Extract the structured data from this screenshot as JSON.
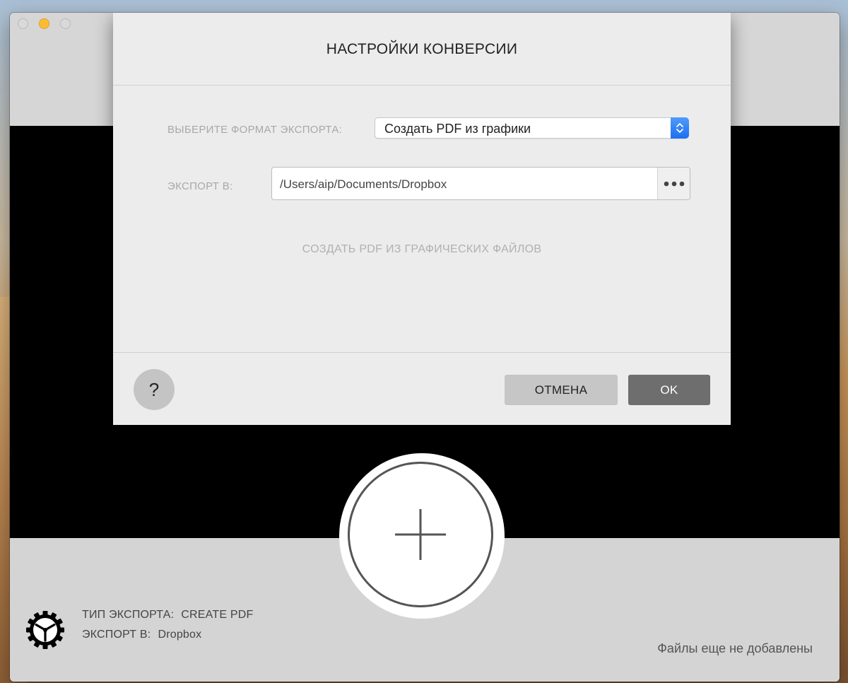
{
  "dialog": {
    "title": "НАСТРОЙКИ КОНВЕРСИИ",
    "format_label": "ВЫБЕРИТЕ ФОРМАТ ЭКСПОРТА:",
    "format_value": "Создать PDF из графики",
    "export_label": "ЭКСПОРТ В:",
    "export_path": "/Users/aip/Documents/Dropbox",
    "hint": "СОЗДАТЬ PDF ИЗ ГРАФИЧЕСКИХ ФАЙЛОВ",
    "help_label": "?",
    "cancel_label": "ОТМЕНА",
    "ok_label": "OK"
  },
  "status": {
    "type_label": "ТИП ЭКСПОРТА:",
    "type_value": "CREATE PDF",
    "dest_label": "ЭКСПОРТ В:",
    "dest_value": "Dropbox",
    "files_message": "Файлы еще не добавлены"
  },
  "colors": {
    "accent_blue": "#1d6ef2",
    "traffic_minimize": "#febc2e",
    "ok_button": "#6e6e6e"
  },
  "icons": {
    "select_stepper": "chevron-updown-icon",
    "browse": "ellipsis-icon",
    "add": "plus-icon",
    "settings": "gear-icon"
  }
}
